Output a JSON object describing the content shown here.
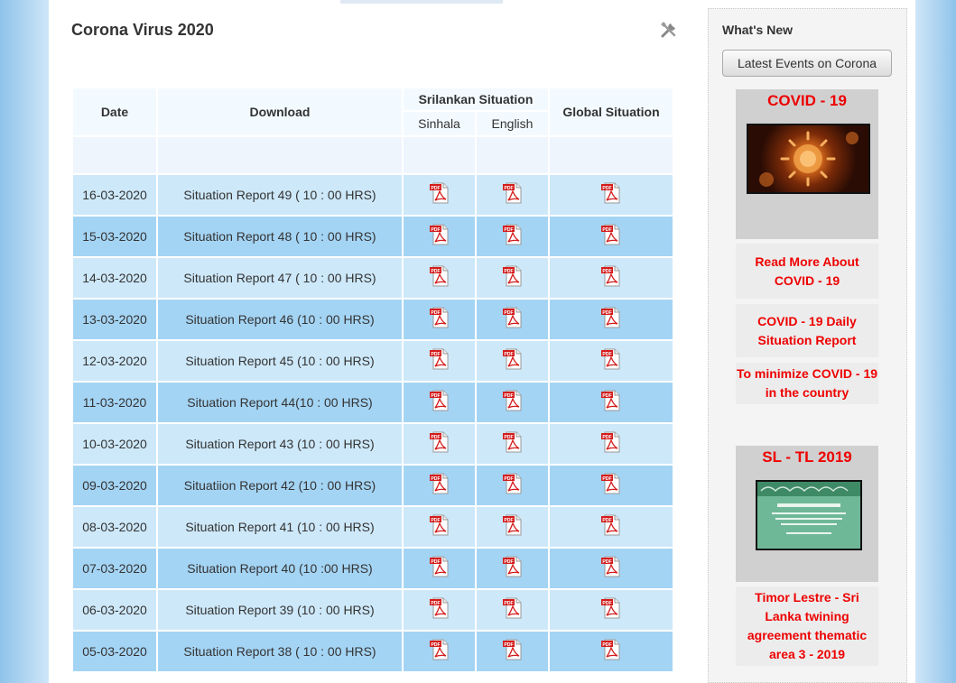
{
  "page": {
    "title": "Corona Virus 2020"
  },
  "table": {
    "headers": {
      "date": "Date",
      "download": "Download",
      "srilankan": "Srilankan Situation",
      "sinhala": "Sinhala",
      "english": "English",
      "global": "Global Situation"
    },
    "rows": [
      {
        "date": "16-03-2020",
        "title": "Situation Report 49 ( 10 : 00 HRS)"
      },
      {
        "date": "15-03-2020",
        "title": "Situation Report 48 ( 10 : 00 HRS)"
      },
      {
        "date": "14-03-2020",
        "title": "Situation Report 47 ( 10 : 00 HRS)"
      },
      {
        "date": "13-03-2020",
        "title": "Situation Report 46 (10 : 00 HRS)"
      },
      {
        "date": "12-03-2020",
        "title": "Situation Report 45 (10 : 00 HRS)"
      },
      {
        "date": "11-03-2020",
        "title": "Situation Report 44(10 : 00 HRS)"
      },
      {
        "date": "10-03-2020",
        "title": "Situation Report 43 (10 : 00 HRS)"
      },
      {
        "date": "09-03-2020",
        "title": "Situatiion Report 42 (10 : 00 HRS)"
      },
      {
        "date": "08-03-2020",
        "title": "Situation Report 41 (10 : 00 HRS)"
      },
      {
        "date": "07-03-2020",
        "title": "Situation Report 40 (10 :00 HRS)"
      },
      {
        "date": "06-03-2020",
        "title": "Situation Report 39 (10 : 00 HRS)"
      },
      {
        "date": "05-03-2020",
        "title": "Situation Report 38 ( 10 : 00 HRS)"
      }
    ],
    "icon": "pdf-icon"
  },
  "sidebar": {
    "heading": "What's New",
    "button_label": "Latest Events on Corona",
    "covid_card": {
      "title": "COVID - 19",
      "links": [
        "Read More About COVID - 19",
        "COVID - 19 Daily Situation Report",
        "To minimize COVID - 19 in the country"
      ]
    },
    "sltl_card": {
      "title": "SL - TL 2019",
      "link": "Timor Lestre - Sri Lanka twining agreement thematic area 3 - 2019"
    }
  },
  "colors": {
    "row_light": "#cde8f9",
    "row_dark": "#a4d4f4",
    "accent_red": "#e00000"
  }
}
